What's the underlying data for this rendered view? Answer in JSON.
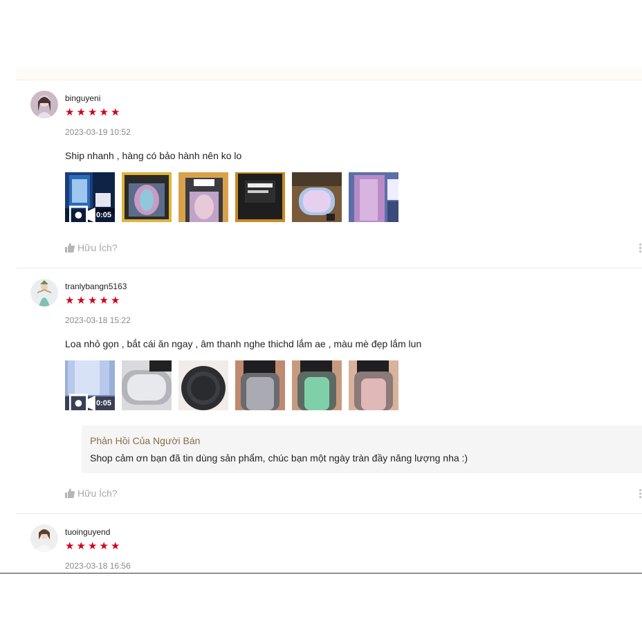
{
  "reviews": [
    {
      "username": "binguyeni",
      "stars": 5,
      "date": "2023-03-19 10:52",
      "comment": "Ship nhanh , hàng có bảo hành nên ko lo",
      "video_duration": "0:05",
      "helpful_label": "Hữu Ích?"
    },
    {
      "username": "tranlybangn5163",
      "stars": 5,
      "date": "2023-03-18 15:22",
      "comment": "Loa nhỏ gọn , bắt cái ăn ngay , âm thanh nghe thichd lắm ae , màu mè đẹp lắm lun",
      "video_duration": "0:05",
      "seller_reply_title": "Phản Hồi Của Người Bán",
      "seller_reply_text": "Shop cảm ơn bạn đã tin dùng sản phẩm, chúc bạn một ngày tràn đầy năng lượng nha :)",
      "helpful_label": "Hữu Ích?"
    },
    {
      "username": "tuoinguyend",
      "stars": 5,
      "date": "2023-03-18 16:56"
    }
  ],
  "colors": {
    "star": "#d0011b",
    "seller_title": "#8c6a4a"
  }
}
